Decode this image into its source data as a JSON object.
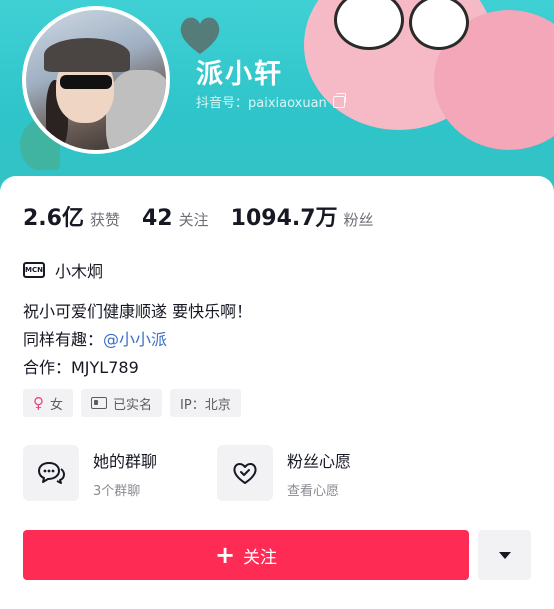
{
  "profile": {
    "nickname": "派小轩",
    "douyin_id": "抖音号：paixiaoxuan"
  },
  "stats": [
    {
      "value": "2.6亿",
      "label": "获赞"
    },
    {
      "value": "42",
      "label": "关注"
    },
    {
      "value": "1094.7万",
      "label": "粉丝"
    }
  ],
  "mcn": {
    "icon_text": "MCN",
    "label": "小木炯"
  },
  "bio": {
    "line1": "祝小可爱们健康顺遂 要快乐啊！",
    "line2_prefix": "同样有趣：",
    "line2_mention": "@小小派",
    "line3": "合作：MJYL789"
  },
  "tags": {
    "gender": "女",
    "verified": "已实名",
    "ip": "IP：北京"
  },
  "entries": [
    {
      "title": "她的群聊",
      "sub": "3个群聊",
      "icon": "chat-bubbles-icon"
    },
    {
      "title": "粉丝心愿",
      "sub": "查看心愿",
      "icon": "heart-wish-icon"
    }
  ],
  "actions": {
    "follow_label": "关注",
    "more_icon": "dropdown-triangle-icon"
  },
  "colors": {
    "banner": "#2ec4c9",
    "follow": "#fe2c55",
    "mention": "#3a6ec6"
  }
}
